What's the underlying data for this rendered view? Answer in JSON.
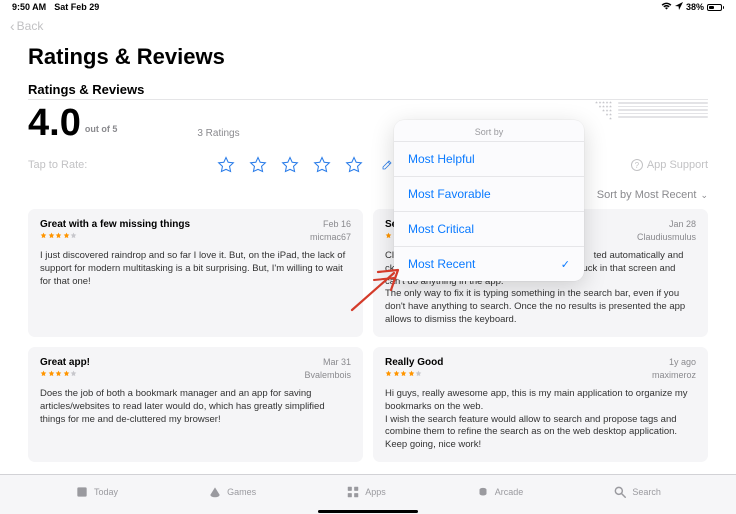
{
  "status": {
    "time": "9:50 AM",
    "date": "Sat Feb 29",
    "battery_pct": "38%"
  },
  "nav": {
    "back": "Back"
  },
  "header": {
    "title": "Ratings & Reviews"
  },
  "section": {
    "title": "Ratings & Reviews"
  },
  "summary": {
    "rating": "4.0",
    "out_of": "out of 5",
    "count": "3 Ratings"
  },
  "rate": {
    "tap": "Tap to Rate:",
    "write": "Write a Review",
    "support": "App Support"
  },
  "sort": {
    "label": "Sort by Most Recent"
  },
  "popup": {
    "title": "Sort by",
    "items": [
      "Most Helpful",
      "Most Favorable",
      "Most Critical",
      "Most Recent"
    ],
    "selected": 3
  },
  "reviews": [
    {
      "title": "Great with a few missing things",
      "date": "Feb 16",
      "author": "micmac67",
      "stars": 4,
      "body": "I just discovered raindrop and so far I love it. But, on the iPad, the lack of support for modern multitasking is a bit surprising. But, I'm willing to wait for that one!"
    },
    {
      "title": "Se",
      "date": "Jan 28",
      "author": "Claudiusmulus",
      "stars": 1,
      "body_pre": "Cli",
      "body_mid": "th",
      "body_rest": "ted automatically and cking in the background doesn't work. You're stuck in that screen and can't do anything in the app.\nThe only way to fix it is typing something in the search bar, even if you don't have anything to search. Once the no results is presented the app allows to dismiss the keyboard."
    },
    {
      "title": "Great app!",
      "date": "Mar 31",
      "author": "Bvalembois",
      "stars": 4,
      "body": "Does the job of both a bookmark manager and an app for saving articles/websites to read later would do, which has greatly simplified things for me and de-cluttered my browser!"
    },
    {
      "title": "Really Good",
      "date": "1y ago",
      "author": "maximeroz",
      "stars": 4,
      "body": "Hi guys, really awesome app, this is my main application to organize my bookmarks on the web.\nI wish the search feature would allow to search and propose tags and combine them to refine the search as on the web desktop application.\nKeep going, nice work!"
    }
  ],
  "tabs": [
    "Today",
    "Games",
    "Apps",
    "Arcade",
    "Search"
  ]
}
